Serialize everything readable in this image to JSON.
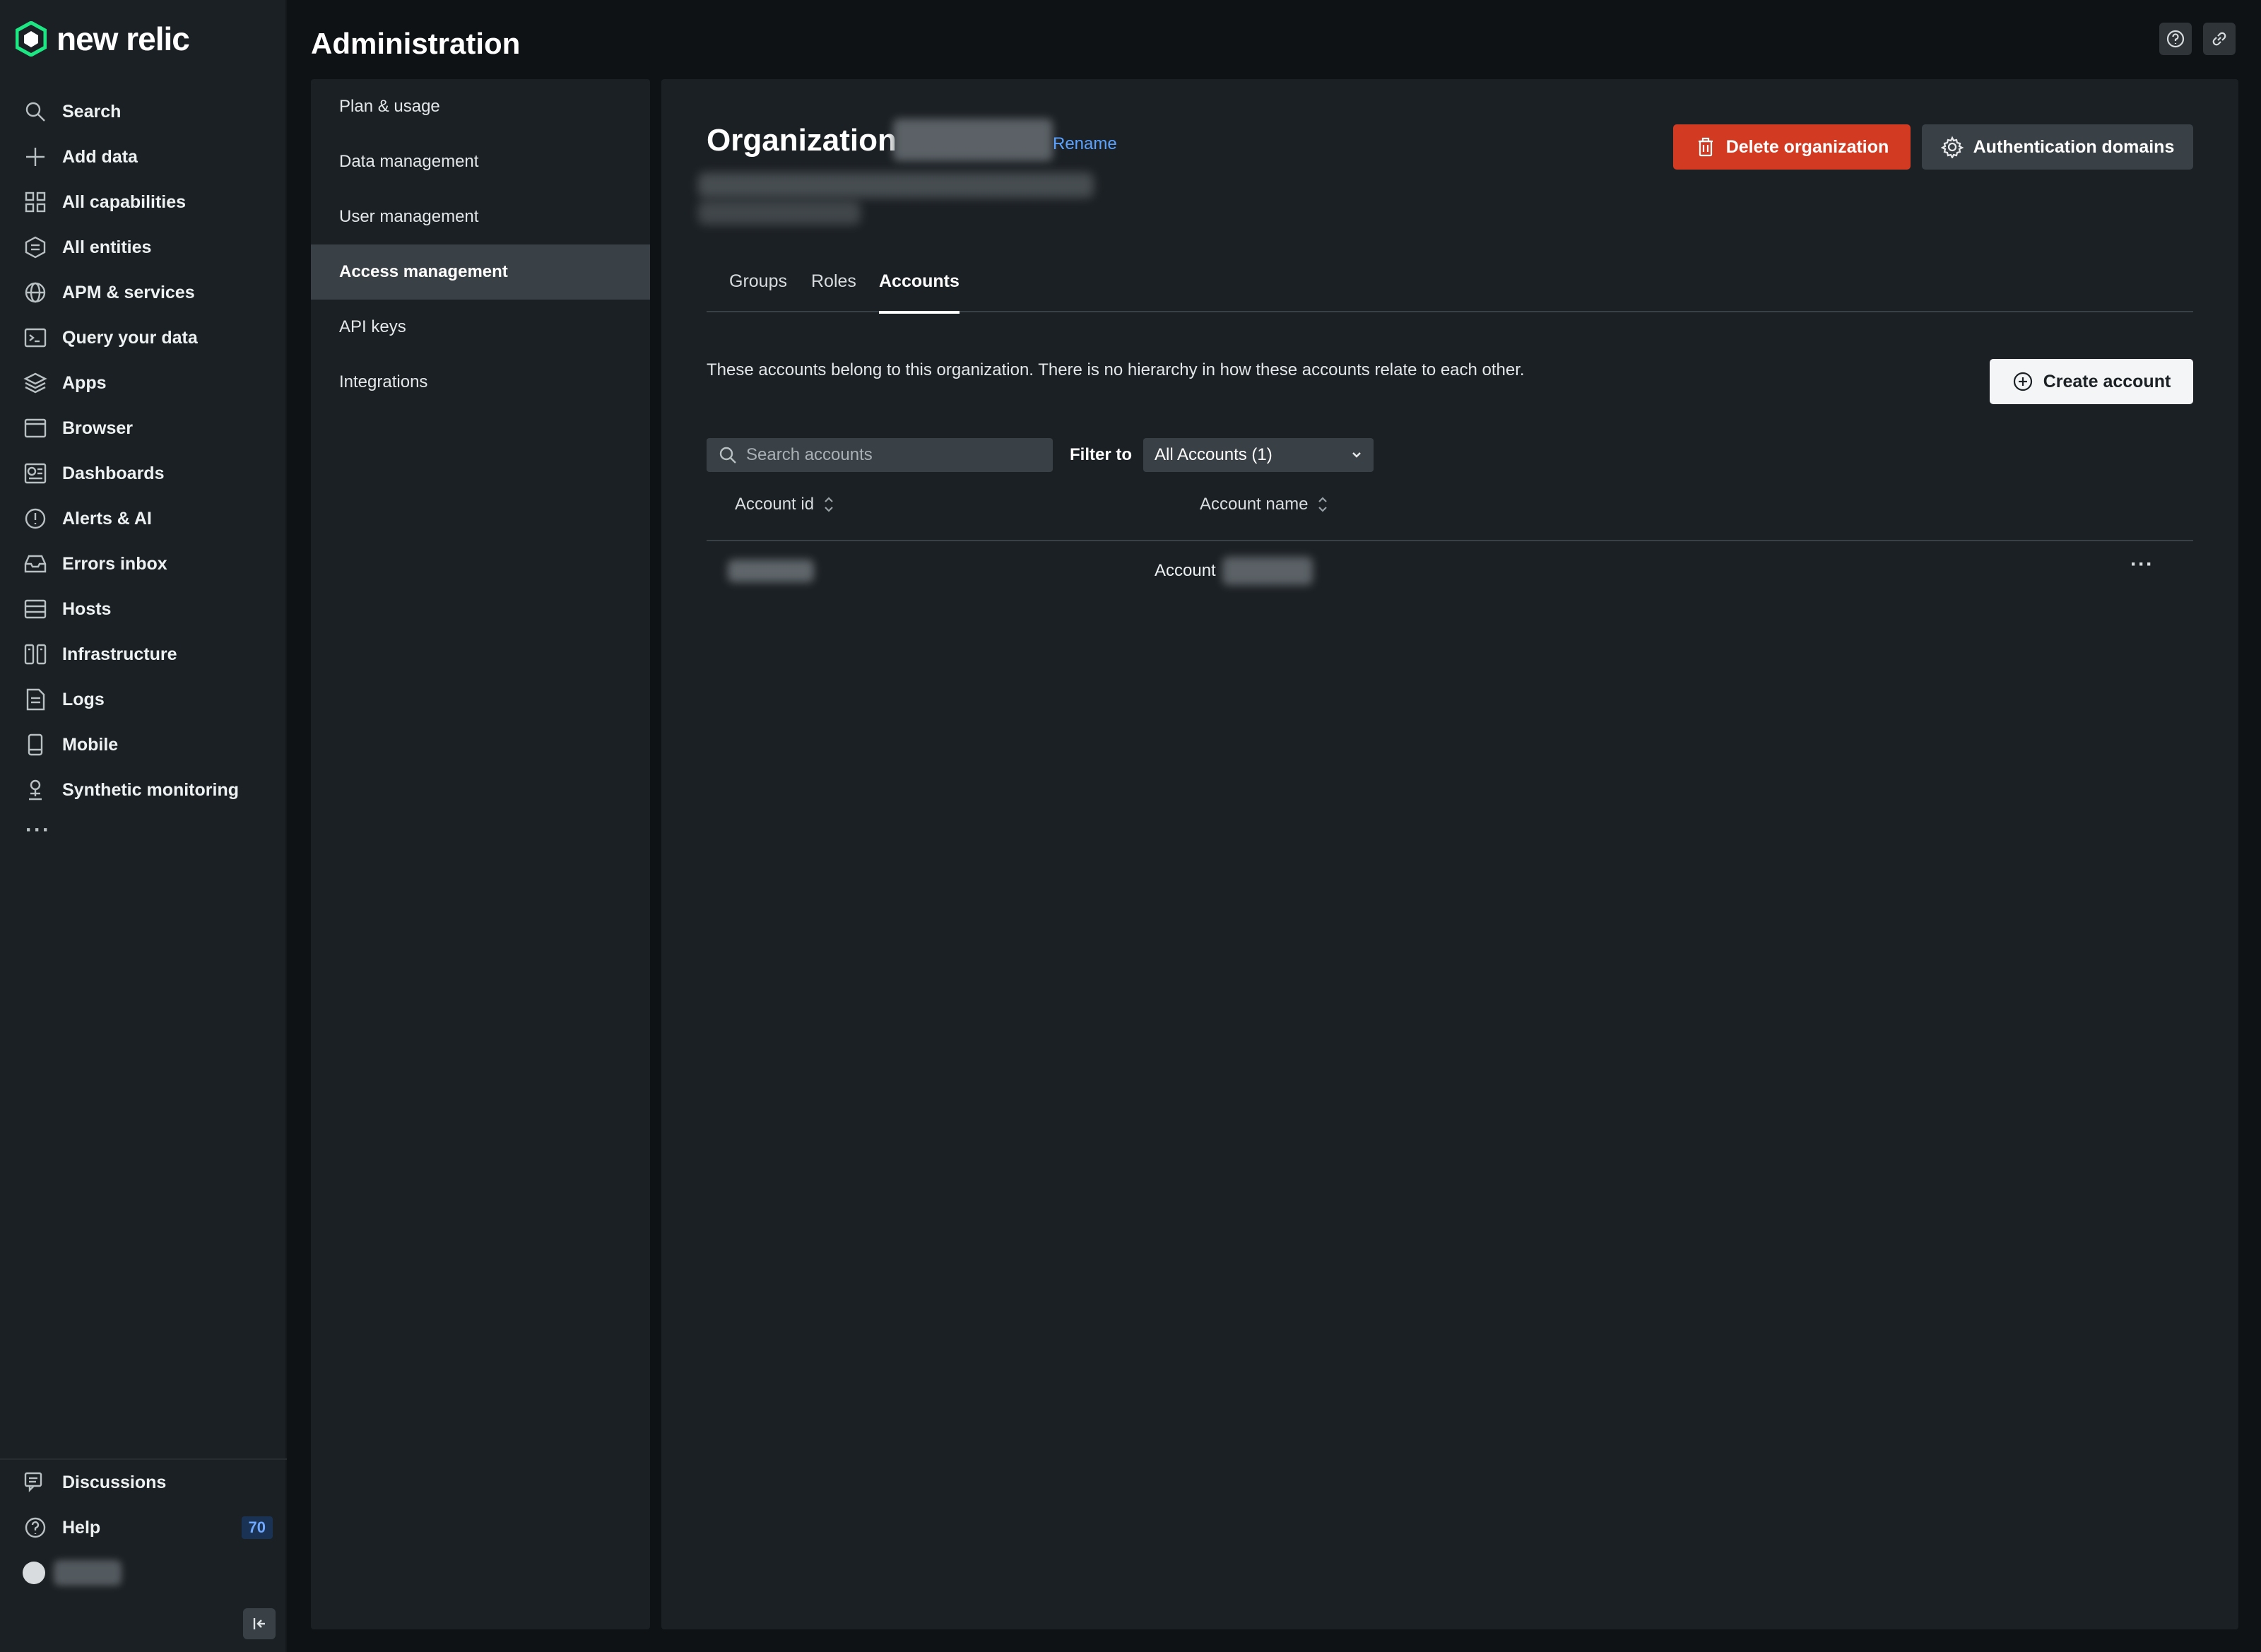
{
  "app": {
    "logo_text": "new relic",
    "brand_color": "#1ce783"
  },
  "nav": {
    "items": [
      {
        "label": "Search",
        "icon": "search-icon"
      },
      {
        "label": "Add data",
        "icon": "plus-icon"
      },
      {
        "label": "All capabilities",
        "icon": "grid-icon"
      },
      {
        "label": "All entities",
        "icon": "entities-icon"
      },
      {
        "label": "APM & services",
        "icon": "globe-icon"
      },
      {
        "label": "Query your data",
        "icon": "terminal-icon"
      },
      {
        "label": "Apps",
        "icon": "layers-icon"
      },
      {
        "label": "Browser",
        "icon": "browser-icon"
      },
      {
        "label": "Dashboards",
        "icon": "dashboard-icon"
      },
      {
        "label": "Alerts & AI",
        "icon": "alert-icon"
      },
      {
        "label": "Errors inbox",
        "icon": "inbox-icon"
      },
      {
        "label": "Hosts",
        "icon": "hosts-icon"
      },
      {
        "label": "Infrastructure",
        "icon": "infrastructure-icon"
      },
      {
        "label": "Logs",
        "icon": "logs-icon"
      },
      {
        "label": "Mobile",
        "icon": "mobile-icon"
      },
      {
        "label": "Synthetic monitoring",
        "icon": "synthetic-icon"
      }
    ],
    "more": "···",
    "bottom": {
      "discussions": "Discussions",
      "help": "Help",
      "help_badge": "70"
    }
  },
  "header": {
    "title": "Administration"
  },
  "subnav": {
    "items": [
      "Plan & usage",
      "Data management",
      "User management",
      "Access management",
      "API keys",
      "Integrations"
    ],
    "active": "Access management"
  },
  "org": {
    "title": "Organization",
    "rename": "Rename",
    "delete_button": "Delete organization",
    "auth_button": "Authentication domains"
  },
  "tabs": {
    "groups": "Groups",
    "roles": "Roles",
    "accounts": "Accounts"
  },
  "accounts": {
    "info": "These accounts belong to this organization. There is no hierarchy in how these accounts relate to each other.",
    "create_button": "Create account",
    "search_placeholder": "Search accounts",
    "filter_label": "Filter to",
    "filter_value": "All Accounts (1)",
    "columns": {
      "id": "Account id",
      "name": "Account name"
    },
    "rows": [
      {
        "name_prefix": "Account",
        "menu": "···"
      }
    ]
  },
  "colors": {
    "danger": "#d33a22",
    "link": "#5aa2ff",
    "panel": "#1b2024",
    "active": "#3a4146"
  }
}
